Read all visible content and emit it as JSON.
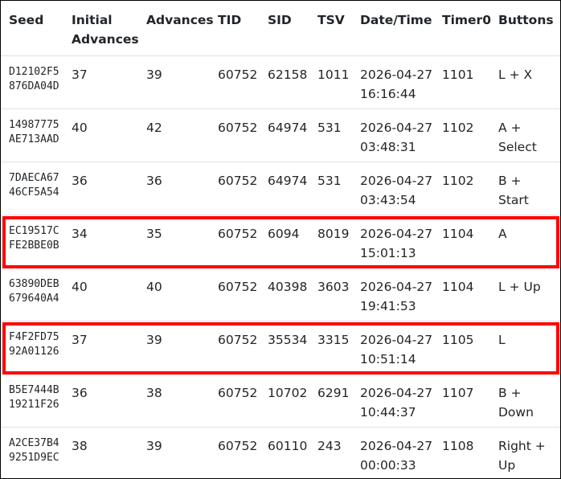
{
  "table": {
    "headers": [
      {
        "key": "seed",
        "lines": [
          "Seed"
        ]
      },
      {
        "key": "initial_advances",
        "lines": [
          "Initial",
          "Advances"
        ]
      },
      {
        "key": "advances",
        "lines": [
          "Advances"
        ]
      },
      {
        "key": "tid",
        "lines": [
          "TID"
        ]
      },
      {
        "key": "sid",
        "lines": [
          "SID"
        ]
      },
      {
        "key": "tsv",
        "lines": [
          "TSV"
        ]
      },
      {
        "key": "datetime",
        "lines": [
          "Date/Time"
        ]
      },
      {
        "key": "timer0",
        "lines": [
          "Timer0"
        ]
      },
      {
        "key": "buttons",
        "lines": [
          "Buttons"
        ]
      }
    ],
    "rows": [
      {
        "seed": [
          "D12102F5",
          "876DA04D"
        ],
        "initial_advances": "37",
        "advances": "39",
        "tid": "60752",
        "sid": "62158",
        "tsv": "1011",
        "date": "2026-04-27",
        "time": "16:16:44",
        "timer0": "1101",
        "buttons": [
          "L + X"
        ],
        "highlighted": false
      },
      {
        "seed": [
          "14987775",
          "AE713AAD"
        ],
        "initial_advances": "40",
        "advances": "42",
        "tid": "60752",
        "sid": "64974",
        "tsv": "531",
        "date": "2026-04-27",
        "time": "03:48:31",
        "timer0": "1102",
        "buttons": [
          "A +",
          "Select"
        ],
        "highlighted": false
      },
      {
        "seed": [
          "7DAECA67",
          "46CF5A54"
        ],
        "initial_advances": "36",
        "advances": "36",
        "tid": "60752",
        "sid": "64974",
        "tsv": "531",
        "date": "2026-04-27",
        "time": "03:43:54",
        "timer0": "1102",
        "buttons": [
          "B +",
          "Start"
        ],
        "highlighted": false
      },
      {
        "seed": [
          "EC19517C",
          "FE2BBE0B"
        ],
        "initial_advances": "34",
        "advances": "35",
        "tid": "60752",
        "sid": "6094",
        "tsv": "8019",
        "date": "2026-04-27",
        "time": "15:01:13",
        "timer0": "1104",
        "buttons": [
          "A"
        ],
        "highlighted": true
      },
      {
        "seed": [
          "63890DEB",
          "679640A4"
        ],
        "initial_advances": "40",
        "advances": "40",
        "tid": "60752",
        "sid": "40398",
        "tsv": "3603",
        "date": "2026-04-27",
        "time": "19:41:53",
        "timer0": "1104",
        "buttons": [
          "L + Up"
        ],
        "highlighted": false
      },
      {
        "seed": [
          "F4F2FD75",
          "92A01126"
        ],
        "initial_advances": "37",
        "advances": "39",
        "tid": "60752",
        "sid": "35534",
        "tsv": "3315",
        "date": "2026-04-27",
        "time": "10:51:14",
        "timer0": "1105",
        "buttons": [
          "L"
        ],
        "highlighted": true
      },
      {
        "seed": [
          "B5E7444B",
          "19211F26"
        ],
        "initial_advances": "36",
        "advances": "38",
        "tid": "60752",
        "sid": "10702",
        "tsv": "6291",
        "date": "2026-04-27",
        "time": "10:44:37",
        "timer0": "1107",
        "buttons": [
          "B +",
          "Down"
        ],
        "highlighted": false
      },
      {
        "seed": [
          "A2CE37B4",
          "9251D9EC"
        ],
        "initial_advances": "38",
        "advances": "39",
        "tid": "60752",
        "sid": "60110",
        "tsv": "243",
        "date": "2026-04-27",
        "time": "00:00:33",
        "timer0": "1108",
        "buttons": [
          "Right +",
          "Up"
        ],
        "highlighted": false
      }
    ]
  },
  "colors": {
    "highlight": "#ff0000",
    "row_border": "#dee2e6",
    "text": "#212529"
  }
}
